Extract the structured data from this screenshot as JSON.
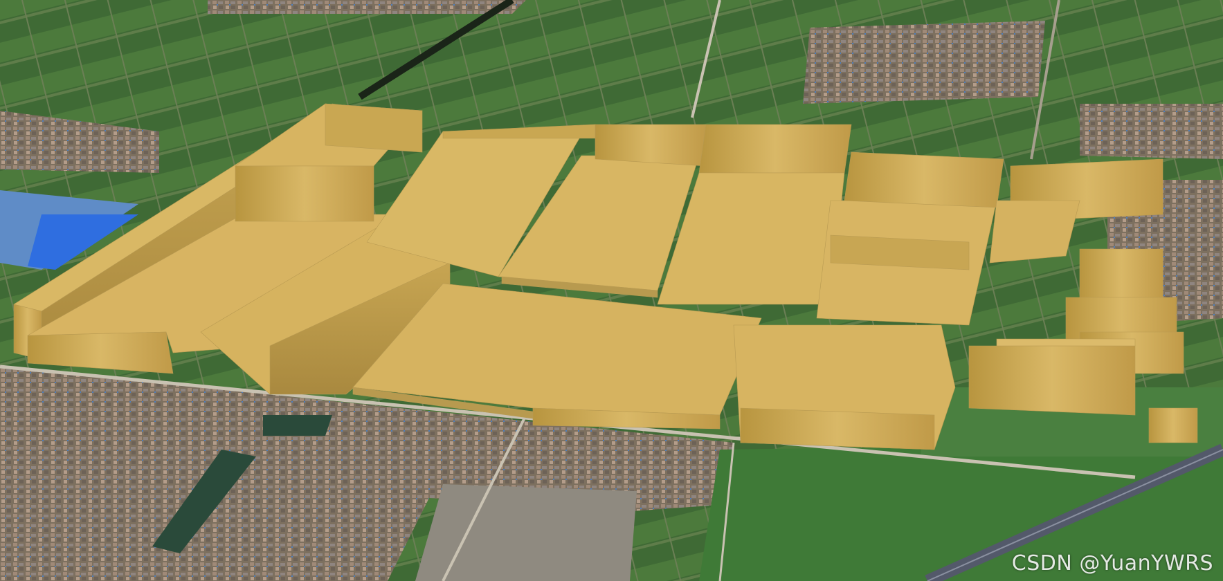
{
  "scene": {
    "type": "3d-extruded-buildings-on-satellite-imagery",
    "building_color": "#d7b260",
    "building_shadow_color": "#a88a43",
    "roof_highlight_color": "#dfbf6e",
    "field_colors": [
      "#3f6a35",
      "#557a3e",
      "#6c8a4d",
      "#2f5a2b"
    ],
    "village_color": "#8a7a6d",
    "road_color": "#c9c2b2",
    "water_color": "#2a4a3a",
    "factory_roof_color": "#3e7fd6"
  },
  "watermark": {
    "text": "CSDN @YuanYWRS"
  }
}
